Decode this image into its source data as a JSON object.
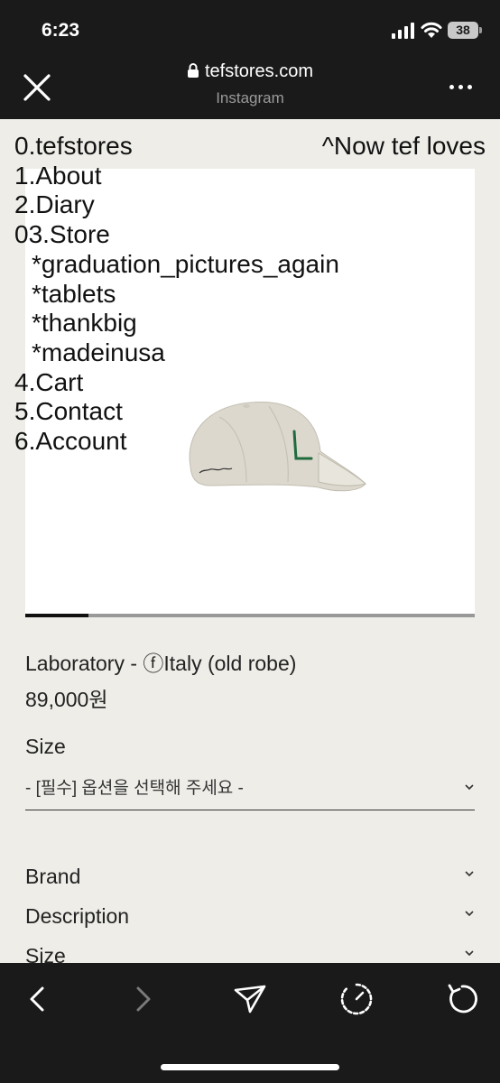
{
  "status": {
    "time": "6:23",
    "battery": "38"
  },
  "browser": {
    "url": "tefstores.com",
    "source": "Instagram"
  },
  "nav": {
    "home": "0.tefstores",
    "about": "1.About",
    "diary": "2.Diary",
    "store": "03.Store",
    "store_sub": [
      "*graduation_pictures_again",
      "*tablets",
      "*thankbig",
      "*madeinusa"
    ],
    "cart": "4.Cart",
    "contact": "5.Contact",
    "account": "6.Account",
    "now": "^Now tef loves"
  },
  "gallery": {
    "progress": 0.14
  },
  "product": {
    "name": "Laboratory - ⓕItaly (old robe)",
    "price": "89,000원",
    "size_label": "Size",
    "size_option": "- [필수] 옵션을 선택해 주세요 -"
  },
  "accordion": {
    "items": [
      "Brand",
      "Description",
      "Size"
    ]
  },
  "colors": {
    "chrome": "#1a1a1a",
    "page_bg": "#eeede8",
    "cap": "#dcd8cd",
    "cap_letter": "#1f6b3e"
  }
}
